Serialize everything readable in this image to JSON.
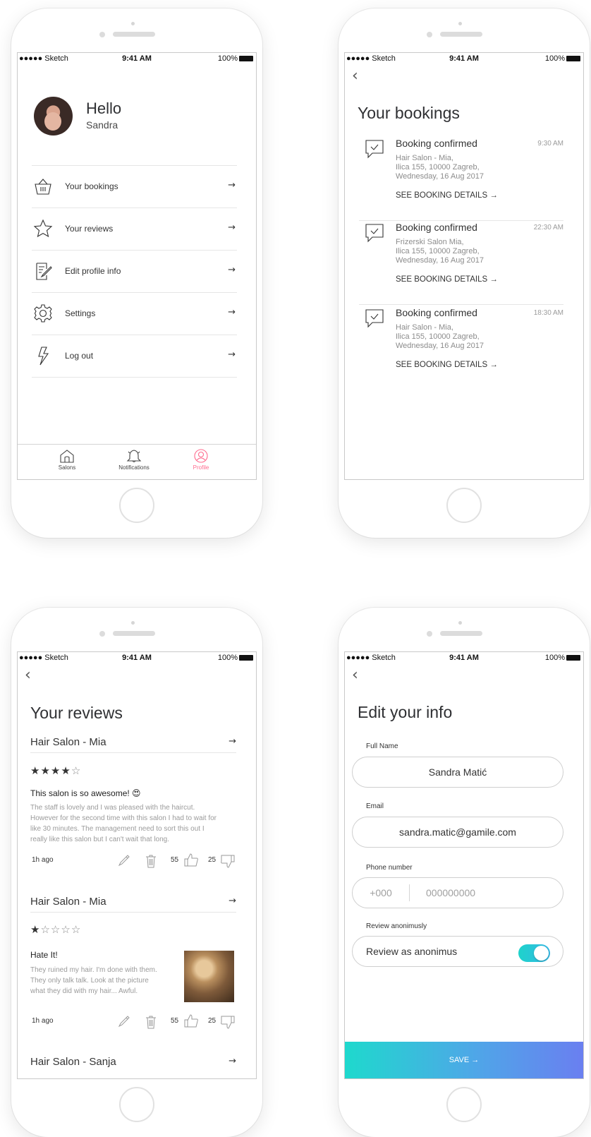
{
  "status_bar": {
    "carrier": "●●●●● Sketch",
    "time": "9:41 AM",
    "battery": "100%"
  },
  "profile": {
    "greeting": "Hello",
    "name": "Sandra",
    "menu": [
      {
        "label": "Your bookings",
        "icon": "basket-icon"
      },
      {
        "label": "Your reviews",
        "icon": "star-icon"
      },
      {
        "label": "Edit profile info",
        "icon": "edit-icon"
      },
      {
        "label": "Settings",
        "icon": "gear-icon"
      },
      {
        "label": "Log out",
        "icon": "lightning-icon"
      }
    ],
    "tabs": [
      {
        "label": "Salons",
        "icon": "home-icon"
      },
      {
        "label": "Notifications",
        "icon": "bell-icon"
      },
      {
        "label": "Profile",
        "icon": "profile-icon"
      }
    ],
    "active_tab": "Profile",
    "accent_color": "#ff6b8e"
  },
  "bookings": {
    "title": "Your bookings",
    "items": [
      {
        "title": "Booking confirmed",
        "time": "9:30 AM",
        "address": [
          "Hair Salon - Mia,",
          "Ilica 155, 10000 Zagreb,",
          "Wednesday, 16 Aug 2017"
        ],
        "link": "SEE BOOKING DETAILS →"
      },
      {
        "title": "Booking confirmed",
        "time": "22:30 AM",
        "address": [
          "Frizerski Salon Mia,",
          "Ilica 155, 10000 Zagreb,",
          "Wednesday, 16 Aug 2017"
        ],
        "link": "SEE BOOKING DETAILS →"
      },
      {
        "title": "Booking confirmed",
        "time": "18:30 AM",
        "address": [
          "Hair Salon - Mia,",
          "Ilica 155, 10000 Zagreb,",
          "Wednesday, 16 Aug 2017"
        ],
        "link": "SEE BOOKING DETAILS →"
      }
    ]
  },
  "reviews": {
    "title": "Your reviews",
    "items": [
      {
        "salon": "Hair Salon - Mia",
        "rating": 4,
        "title": "This salon is so awesome! 😍",
        "body": [
          "The staff is lovely and I was pleased with the haircut.",
          "However for the second time with this salon I had to wait for",
          "like 30 minutes. The management need to sort this out I",
          "really like this salon but I can't wait that long."
        ],
        "ago": "1h ago",
        "likes": "55",
        "dislikes": "25"
      },
      {
        "salon": "Hair Salon - Mia",
        "rating": 1,
        "title": "Hate It!",
        "body": [
          "They ruined my hair. I'm done with them.",
          "They only talk talk. Look at the picture",
          "what they did with my hair... Awful."
        ],
        "ago": "1h ago",
        "likes": "55",
        "dislikes": "25"
      },
      {
        "salon": "Hair Salon - Sanja"
      }
    ]
  },
  "edit_info": {
    "title": "Edit your info",
    "full_name_label": "Full Name",
    "full_name_value": "Sandra Matić",
    "email_label": "Email",
    "email_value": "sandra.matic@gamile.com",
    "phone_label": "Phone number",
    "phone_prefix_placeholder": "+000",
    "phone_number_placeholder": "000000000",
    "review_label": "Review anonimusly",
    "review_toggle_label": "Review as anonimus",
    "review_toggle_on": true,
    "save_label": "SAVE →"
  },
  "arrow": "→"
}
